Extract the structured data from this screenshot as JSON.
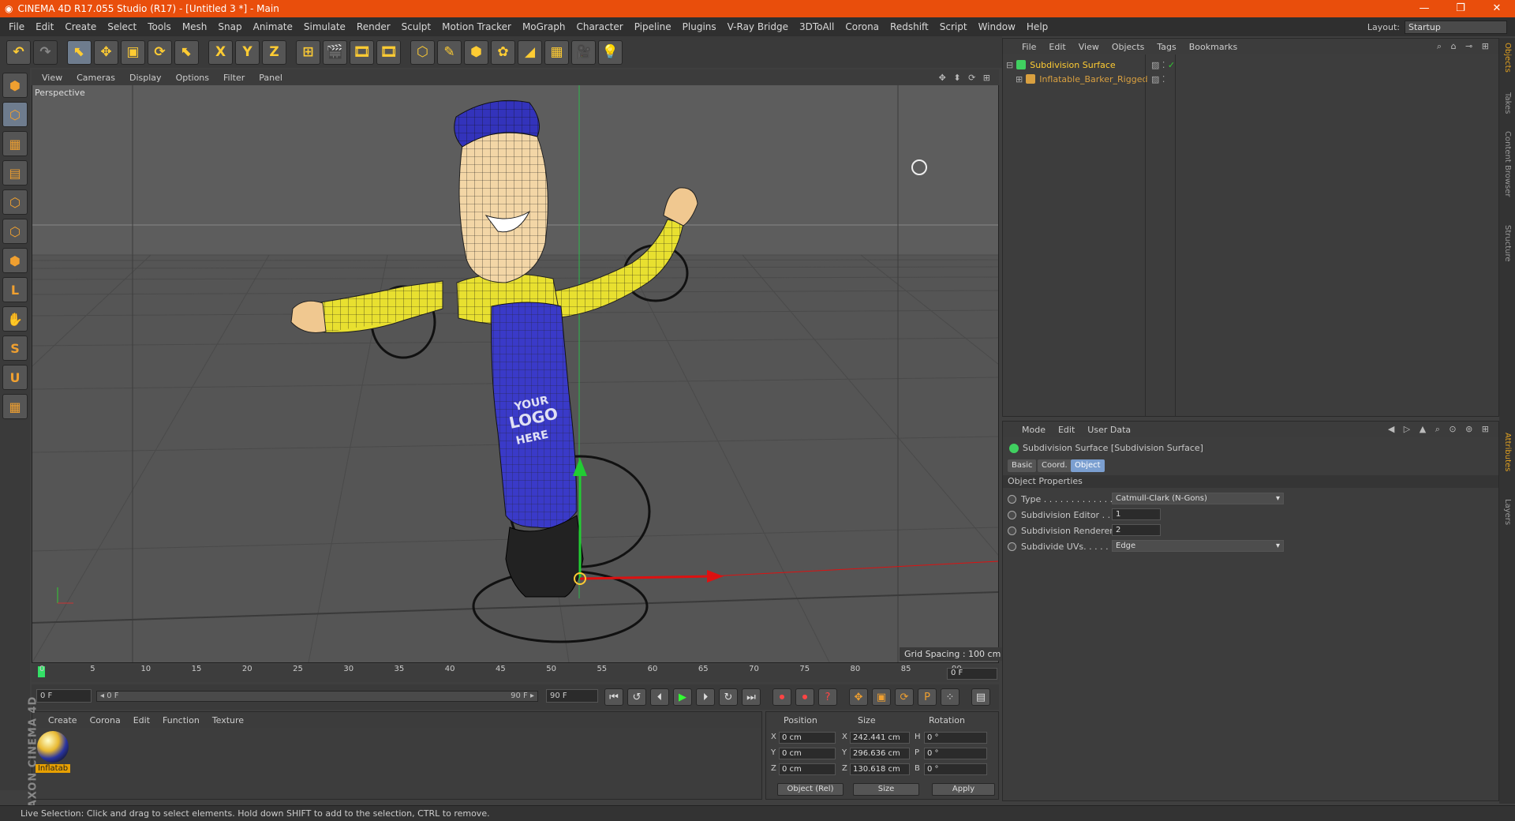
{
  "title": "CINEMA 4D R17.055 Studio (R17) - [Untitled 3 *] - Main",
  "menu": [
    "File",
    "Edit",
    "Create",
    "Select",
    "Tools",
    "Mesh",
    "Snap",
    "Animate",
    "Simulate",
    "Render",
    "Sculpt",
    "Motion Tracker",
    "MoGraph",
    "Character",
    "Pipeline",
    "Plugins",
    "V-Ray Bridge",
    "3DToAll",
    "Corona",
    "Redshift",
    "Script",
    "Window",
    "Help"
  ],
  "layout_label": "Layout:",
  "layout_value": "Startup",
  "toolbar_icons": [
    "undo-icon",
    "redo-icon",
    "live-selection-icon",
    "move-icon",
    "scale-icon",
    "rotate-icon",
    "last-tool-icon",
    "x-axis-icon",
    "y-axis-icon",
    "z-axis-icon",
    "coordinate-system-icon",
    "render-view-icon",
    "render-picture-viewer-icon",
    "edit-render-settings-icon",
    "cube-icon",
    "pen-icon",
    "subdivision-surface-icon",
    "cloner-icon",
    "deformer-icon",
    "floor-icon",
    "camera-icon",
    "light-icon"
  ],
  "toolbar_glyphs": [
    "↶",
    "↷",
    "⬉",
    "✥",
    "▣",
    "⟳",
    "⬉",
    "X",
    "Y",
    "Z",
    "⊞",
    "🎬",
    "🎞",
    "🎞",
    "⬡",
    "✎",
    "⬢",
    "✿",
    "◢",
    "▦",
    "🎥",
    "💡"
  ],
  "left_tools": [
    "make-editable-icon",
    "model-mode-icon",
    "texture-mode-icon",
    "point-mode-icon",
    "edge-mode-icon",
    "polygon-mode-icon",
    "axis-icon",
    "tweak-icon",
    "snap-icon",
    "magnet-icon",
    "workplane-icon",
    "locked-workplane-icon"
  ],
  "left_glyphs": [
    "⬢",
    "⬡",
    "▦",
    "▤",
    "⬡",
    "⬡",
    "⬢",
    "L",
    "✋",
    "S",
    "U",
    "▦"
  ],
  "viewport": {
    "menu": [
      "View",
      "Cameras",
      "Display",
      "Options",
      "Filter",
      "Panel"
    ],
    "label": "Perspective",
    "grid_spacing": "Grid Spacing : 100 cm",
    "nav": "✥ ⬍ ⟳ ⊞"
  },
  "model": {
    "logo_line1": "YOUR",
    "logo_line2": "LOGO",
    "logo_line3": "HERE"
  },
  "timeline": {
    "ticks": [
      "0",
      "5",
      "10",
      "15",
      "20",
      "25",
      "30",
      "35",
      "40",
      "45",
      "50",
      "55",
      "60",
      "65",
      "70",
      "75",
      "80",
      "85",
      "90"
    ],
    "current_frame": "0 F"
  },
  "transport": {
    "start": "0 F",
    "slider_start": "◂ 0 F",
    "slider_end": "90 F ▸",
    "end": "90 F"
  },
  "transport_icons": [
    "go-to-start-icon",
    "prev-key-icon",
    "prev-frame-icon",
    "play-icon",
    "next-frame-icon",
    "next-key-icon",
    "go-to-end-icon",
    "record-icon",
    "autokey-icon",
    "keyframe-selection-icon",
    "position-key-icon",
    "scale-key-icon",
    "rotation-key-icon",
    "param-key-icon",
    "pla-key-icon",
    "timeline-icon"
  ],
  "transport_glyphs": [
    "⏮",
    "↺",
    "⏴",
    "▶",
    "⏵",
    "↻",
    "⏭",
    "⏺",
    "⏺",
    "?",
    "✥",
    "▣",
    "⟳",
    "P",
    "⁘",
    "▤"
  ],
  "material": {
    "menu": [
      "Create",
      "Corona",
      "Edit",
      "Function",
      "Texture"
    ],
    "name": "Inflatab"
  },
  "coords": {
    "headers": [
      "Position",
      "Size",
      "Rotation"
    ],
    "rows": [
      {
        "axis": "X",
        "pos": "0 cm",
        "size_axis": "X",
        "size": "242.441 cm",
        "rot_axis": "H",
        "rot": "0 °"
      },
      {
        "axis": "Y",
        "pos": "0 cm",
        "size_axis": "Y",
        "size": "296.636 cm",
        "rot_axis": "P",
        "rot": "0 °"
      },
      {
        "axis": "Z",
        "pos": "0 cm",
        "size_axis": "Z",
        "size": "130.618 cm",
        "rot_axis": "B",
        "rot": "0 °"
      }
    ],
    "mode_select": "Object (Rel)",
    "size_select": "Size",
    "apply": "Apply"
  },
  "brand": "MAXON CINEMA 4D",
  "status": "Live Selection: Click and drag to select elements. Hold down SHIFT to add to the selection, CTRL to remove.",
  "object_manager": {
    "menu": [
      "File",
      "Edit",
      "View",
      "Objects",
      "Tags",
      "Bookmarks"
    ],
    "icons": "⌕ ⌂ ⊸ ⊞",
    "objects": [
      {
        "name": "Subdivision Surface",
        "color": "#ffcc33"
      },
      {
        "name": "Inflatable_Barker_Rigged",
        "color": "#d9a040"
      }
    ]
  },
  "attributes": {
    "menu": [
      "Mode",
      "Edit",
      "User Data"
    ],
    "icons": "◀ ▷ ▲ ⌕ ⊙ ⊚ ⊞",
    "header": "Subdivision Surface [Subdivision Surface]",
    "tabs": [
      "Basic",
      "Coord.",
      "Object"
    ],
    "active_tab": "Object",
    "section": "Object Properties",
    "props": [
      {
        "label": "Type . . . . . . . . . . . . . .",
        "value": "Catmull-Clark (N-Gons)",
        "kind": "select"
      },
      {
        "label": "Subdivision Editor . .",
        "value": "1",
        "kind": "num"
      },
      {
        "label": "Subdivision Renderer",
        "value": "2",
        "kind": "num"
      },
      {
        "label": "Subdivide UVs. . . . . .",
        "value": "Edge",
        "kind": "select"
      }
    ]
  },
  "right_tabs": [
    "Objects",
    "Takes",
    "Content Browser",
    "Structure",
    "Attributes",
    "Layers"
  ],
  "colors": {
    "title_bar": "#e94e0c",
    "accent_orange": "#ffcc33",
    "active_tab": "#7b9fd0",
    "timeline_cursor": "#33e066"
  }
}
